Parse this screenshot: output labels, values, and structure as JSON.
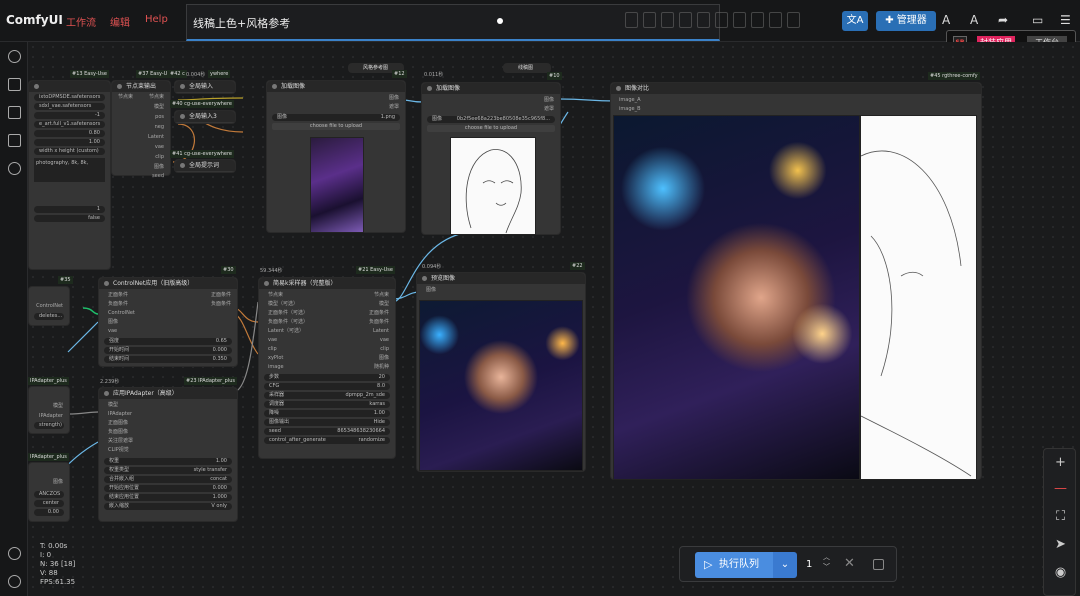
{
  "topbar": {
    "brand": "ComfyUI",
    "menu": [
      "工作流",
      "编辑",
      "Help"
    ],
    "workflow_title": "线稿上色+风格参考",
    "manager_label": "管理器",
    "translate_icon": "translate-icon"
  },
  "popup": {
    "sb_label": "SB",
    "pack_label": "封装应用",
    "desk_label": "工作台"
  },
  "colors": {
    "accent": "#3b82c9",
    "menu_red": "#e05252",
    "run_blue": "#4a8de0",
    "pink": "#e0245e"
  },
  "stats": {
    "t": "T: 0.00s",
    "i": "I: 0",
    "n": "N: 36 [18]",
    "v": "V: 88",
    "fps": "FPS:61.35"
  },
  "run": {
    "label": "执行队列",
    "count": "1"
  },
  "nodes": {
    "n13": {
      "badge": "#13 Easy-Use"
    },
    "n37": {
      "badge": "#37 Easy-U",
      "title": "节点束输出",
      "ports_in": [
        "节点束"
      ],
      "ports_out": [
        "节点束",
        "模型",
        "pos",
        "neg",
        "Latent",
        "vae",
        "clip",
        "图像",
        "seed"
      ]
    },
    "n42": {
      "badge": "#42 c",
      "time": "0.004秒",
      "title": "全局输入",
      "badge2": "ywhere"
    },
    "n40": {
      "badge": "#40 cg-use-everywhere",
      "title": "全局输入3"
    },
    "n41": {
      "badge": "#41 cg-use-everywhere",
      "title": "全局提示词"
    },
    "left_widgets": [
      "ixtoDPMSDE.safetensors",
      "sdxl_vae.safetensors",
      "-1",
      "e_art.full_v1.safetensors",
      "0.80",
      "1.00",
      "width x height (custom)"
    ],
    "left_text": "photography, 8k, 8k,",
    "left_w2": [
      "1",
      "false"
    ],
    "load1": {
      "badge": "#12",
      "title": "加载图像",
      "widget_label": "图像",
      "widget_value": "1.png",
      "upload": "choose file to upload",
      "ports_out": [
        "图像",
        "遮罩"
      ]
    },
    "style_ref": {
      "title": "风格参考图"
    },
    "load2": {
      "badge": "#10",
      "time": "0.011秒",
      "title": "加载图像",
      "widget_label": "图像",
      "widget_value": "0b2f5ee68a223be80508e35c965f8...",
      "upload": "choose file to upload",
      "ports_out": [
        "图像",
        "遮罩"
      ]
    },
    "lineart": {
      "title": "线稿图"
    },
    "compare": {
      "badge": "#45 rgthree-comfy",
      "title": "图像对比",
      "ports_in": [
        "image_A",
        "image_B"
      ]
    },
    "n35": {
      "badge": "#35",
      "port": "ControlNet",
      "widget": "deletes..."
    },
    "cn": {
      "badge": "#30",
      "title": "ControlNet应用（旧版高级）",
      "ports_in": [
        "正面条件",
        "负面条件",
        "ControlNet",
        "图像",
        "vae"
      ],
      "ports_out": [
        "正面条件",
        "负面条件"
      ],
      "widgets": [
        [
          "强度",
          "0.65"
        ],
        [
          "开始时间",
          "0.000"
        ],
        [
          "结束时间",
          "0.350"
        ]
      ]
    },
    "ksampler": {
      "badge": "#21 Easy-Use",
      "time": "59.344秒",
      "title": "简易k采样器（完整版）",
      "ports_in": [
        "节点束",
        "模型（可选）",
        "正面条件（可选）",
        "负面条件（可选）",
        "Latent（可选）",
        "vae",
        "clip",
        "xyPlot",
        "image"
      ],
      "ports_out": [
        "节点束",
        "模型",
        "正面条件",
        "负面条件",
        "Latent",
        "vae",
        "clip",
        "图像",
        "随机种"
      ],
      "widgets": [
        [
          "步数",
          "20"
        ],
        [
          "CFG",
          "8.0"
        ],
        [
          "采样器",
          "dpmpp_2m_sde"
        ],
        [
          "调度器",
          "karras"
        ],
        [
          "降噪",
          "1.00"
        ],
        [
          "图像输出",
          "Hide"
        ],
        [
          "seed",
          "865348638230664"
        ],
        [
          "control_after_generate",
          "randomize"
        ]
      ]
    },
    "preview": {
      "badge": "#22",
      "time": "0.094秒",
      "title": "预览图像",
      "ports_in": [
        "图像"
      ]
    },
    "ipa_left1": {
      "badge": "IPAdapter_plus",
      "ports": [
        "模型",
        "IPAdapter"
      ],
      "widget": "strength)"
    },
    "ipa": {
      "badge": "#23 IPAdapter_plus",
      "time": "2.239秒",
      "title": "应用IPAdapter（高级）",
      "ports_in": [
        "模型",
        "IPAdapter",
        "正面图像",
        "负面图像",
        "关注层遮罩",
        "CLIP视觉"
      ],
      "widgets": [
        [
          "权重",
          "1.00"
        ],
        [
          "权重类型",
          "style transfer"
        ],
        [
          "合并嵌入组",
          "concat"
        ],
        [
          "开始应用位置",
          "0.000"
        ],
        [
          "结束应用位置",
          "1.000"
        ],
        [
          "嵌入缩放",
          "V only"
        ]
      ]
    },
    "ipa_left2": {
      "badge": "IPAdapter_plus",
      "port": "图像",
      "widgets": [
        "ANCZOS",
        "center",
        "0.00"
      ]
    }
  }
}
